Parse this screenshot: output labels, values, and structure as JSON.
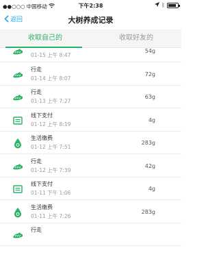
{
  "status_bar": {
    "carrier": "中国移动",
    "time": "下午2:38",
    "battery_level": 0.85
  },
  "nav": {
    "back_label": "返回",
    "title": "大树养成记录"
  },
  "tabs": [
    {
      "label": "收取自己的",
      "active": true
    },
    {
      "label": "收取好友的",
      "active": false
    }
  ],
  "records": [
    {
      "icon": "walk-icon",
      "title": "",
      "time": "01-15 上午 8:47",
      "amount": "54g"
    },
    {
      "icon": "walk-icon",
      "title": "行走",
      "time": "01-14 上午 8:07",
      "amount": "72g"
    },
    {
      "icon": "walk-icon",
      "title": "行走",
      "time": "01-13 上午 7:27",
      "amount": "63g"
    },
    {
      "icon": "payment-icon",
      "title": "线下支付",
      "time": "01-12 上午 8:19",
      "amount": "4g"
    },
    {
      "icon": "utility-icon",
      "title": "生活缴费",
      "time": "01-12 上午 7:51",
      "amount": "283g"
    },
    {
      "icon": "walk-icon",
      "title": "行走",
      "time": "01-12 上午 7:39",
      "amount": "42g"
    },
    {
      "icon": "payment-icon",
      "title": "线下支付",
      "time": "01-11 下午 1:06",
      "amount": "4g"
    },
    {
      "icon": "utility-icon",
      "title": "生活缴费",
      "time": "01-11 上午 7:26",
      "amount": "283g"
    },
    {
      "icon": "walk-icon",
      "title": "行走",
      "time": "",
      "amount": ""
    }
  ],
  "colors": {
    "accent": "#2db268",
    "link": "#1aaaf0"
  }
}
